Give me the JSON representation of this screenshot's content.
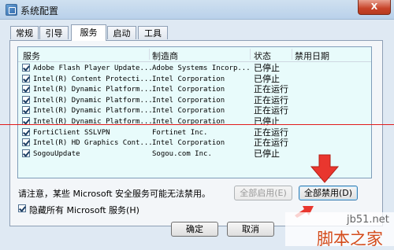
{
  "window": {
    "title": "系统配置",
    "close_label": "X"
  },
  "tabs": [
    {
      "label": "常规"
    },
    {
      "label": "引导"
    },
    {
      "label": "服务"
    },
    {
      "label": "启动"
    },
    {
      "label": "工具"
    }
  ],
  "active_tab": "服务",
  "columns": {
    "service": "服务",
    "manufacturer": "制造商",
    "status": "状态",
    "disabled_date": "禁用日期"
  },
  "services": [
    {
      "name": "Adobe Flash Player Update...",
      "manufacturer": "Adobe Systems Incorp...",
      "status": "已停止",
      "checked": true
    },
    {
      "name": "Intel(R) Content Protecti...",
      "manufacturer": "Intel Corporation",
      "status": "已停止",
      "checked": true
    },
    {
      "name": "Intel(R) Dynamic Platform...",
      "manufacturer": "Intel Corporation",
      "status": "正在运行",
      "checked": true
    },
    {
      "name": "Intel(R) Dynamic Platform...",
      "manufacturer": "Intel Corporation",
      "status": "正在运行",
      "checked": true
    },
    {
      "name": "Intel(R) Dynamic Platform...",
      "manufacturer": "Intel Corporation",
      "status": "正在运行",
      "checked": true
    },
    {
      "name": "Intel(R) Dynamic Platform...",
      "manufacturer": "Intel Corporation",
      "status": "已停止",
      "checked": true
    },
    {
      "name": "FortiClient SSLVPN",
      "manufacturer": "Fortinet Inc.",
      "status": "正在运行",
      "checked": true
    },
    {
      "name": "Intel(R) HD Graphics Cont...",
      "manufacturer": "Intel Corporation",
      "status": "正在运行",
      "checked": true
    },
    {
      "name": "SogouUpdate",
      "manufacturer": "Sogou.com Inc.",
      "status": "已停止",
      "checked": true
    }
  ],
  "notice": "请注意，某些 Microsoft 安全服务可能无法禁用。",
  "buttons": {
    "enable_all": "全部启用(E)",
    "disable_all": "全部禁用(D)",
    "ok": "确定",
    "cancel": "取消"
  },
  "hide_ms": {
    "label": "隐藏所有 Microsoft 服务(H)",
    "checked": true
  },
  "watermark": {
    "url": "jb51.net",
    "brand": "脚本之家"
  },
  "colors": {
    "annotation_red": "#e21b1b",
    "list_background": "#e8fbfb",
    "arrow_fill": "#e9362e"
  }
}
